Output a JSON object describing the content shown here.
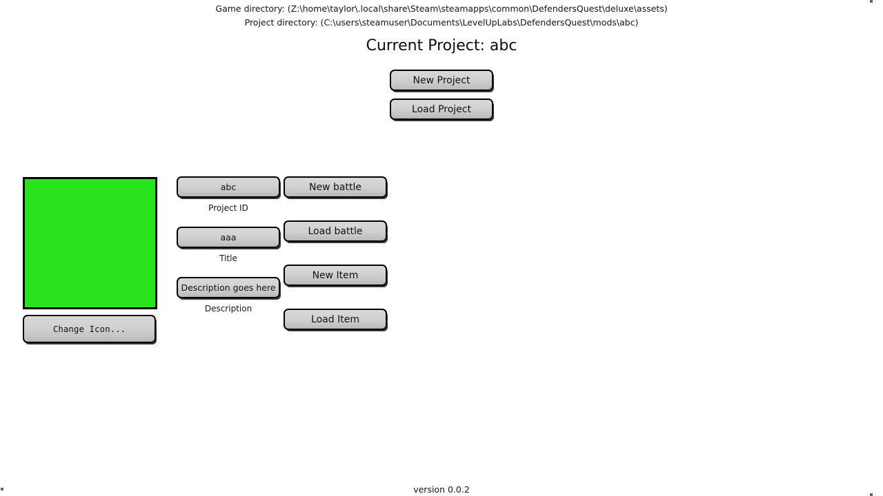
{
  "header": {
    "game_directory": "Game directory: (Z:\\home\\taylor\\.local\\share\\Steam\\steamapps\\common\\DefendersQuest\\deluxe\\assets)",
    "project_directory": "Project directory: (C:\\users\\steamuser\\Documents\\LevelUpLabs\\DefendersQuest\\mods\\abc)",
    "current_project": "Current Project: abc"
  },
  "top_buttons": {
    "new_project": "New Project",
    "load_project": "Load Project"
  },
  "icon_panel": {
    "icon_color": "#28e31e",
    "change_icon_label": "Change Icon..."
  },
  "fields": [
    {
      "value": "abc",
      "label": "Project ID"
    },
    {
      "value": "aaa",
      "label": "Title"
    },
    {
      "value": "Description goes here",
      "label": "Description"
    }
  ],
  "actions": [
    {
      "label": "New battle"
    },
    {
      "label": "Load battle"
    },
    {
      "label": "New Item"
    },
    {
      "label": "Load Item"
    }
  ],
  "footer": {
    "version": "version 0.0.2"
  }
}
